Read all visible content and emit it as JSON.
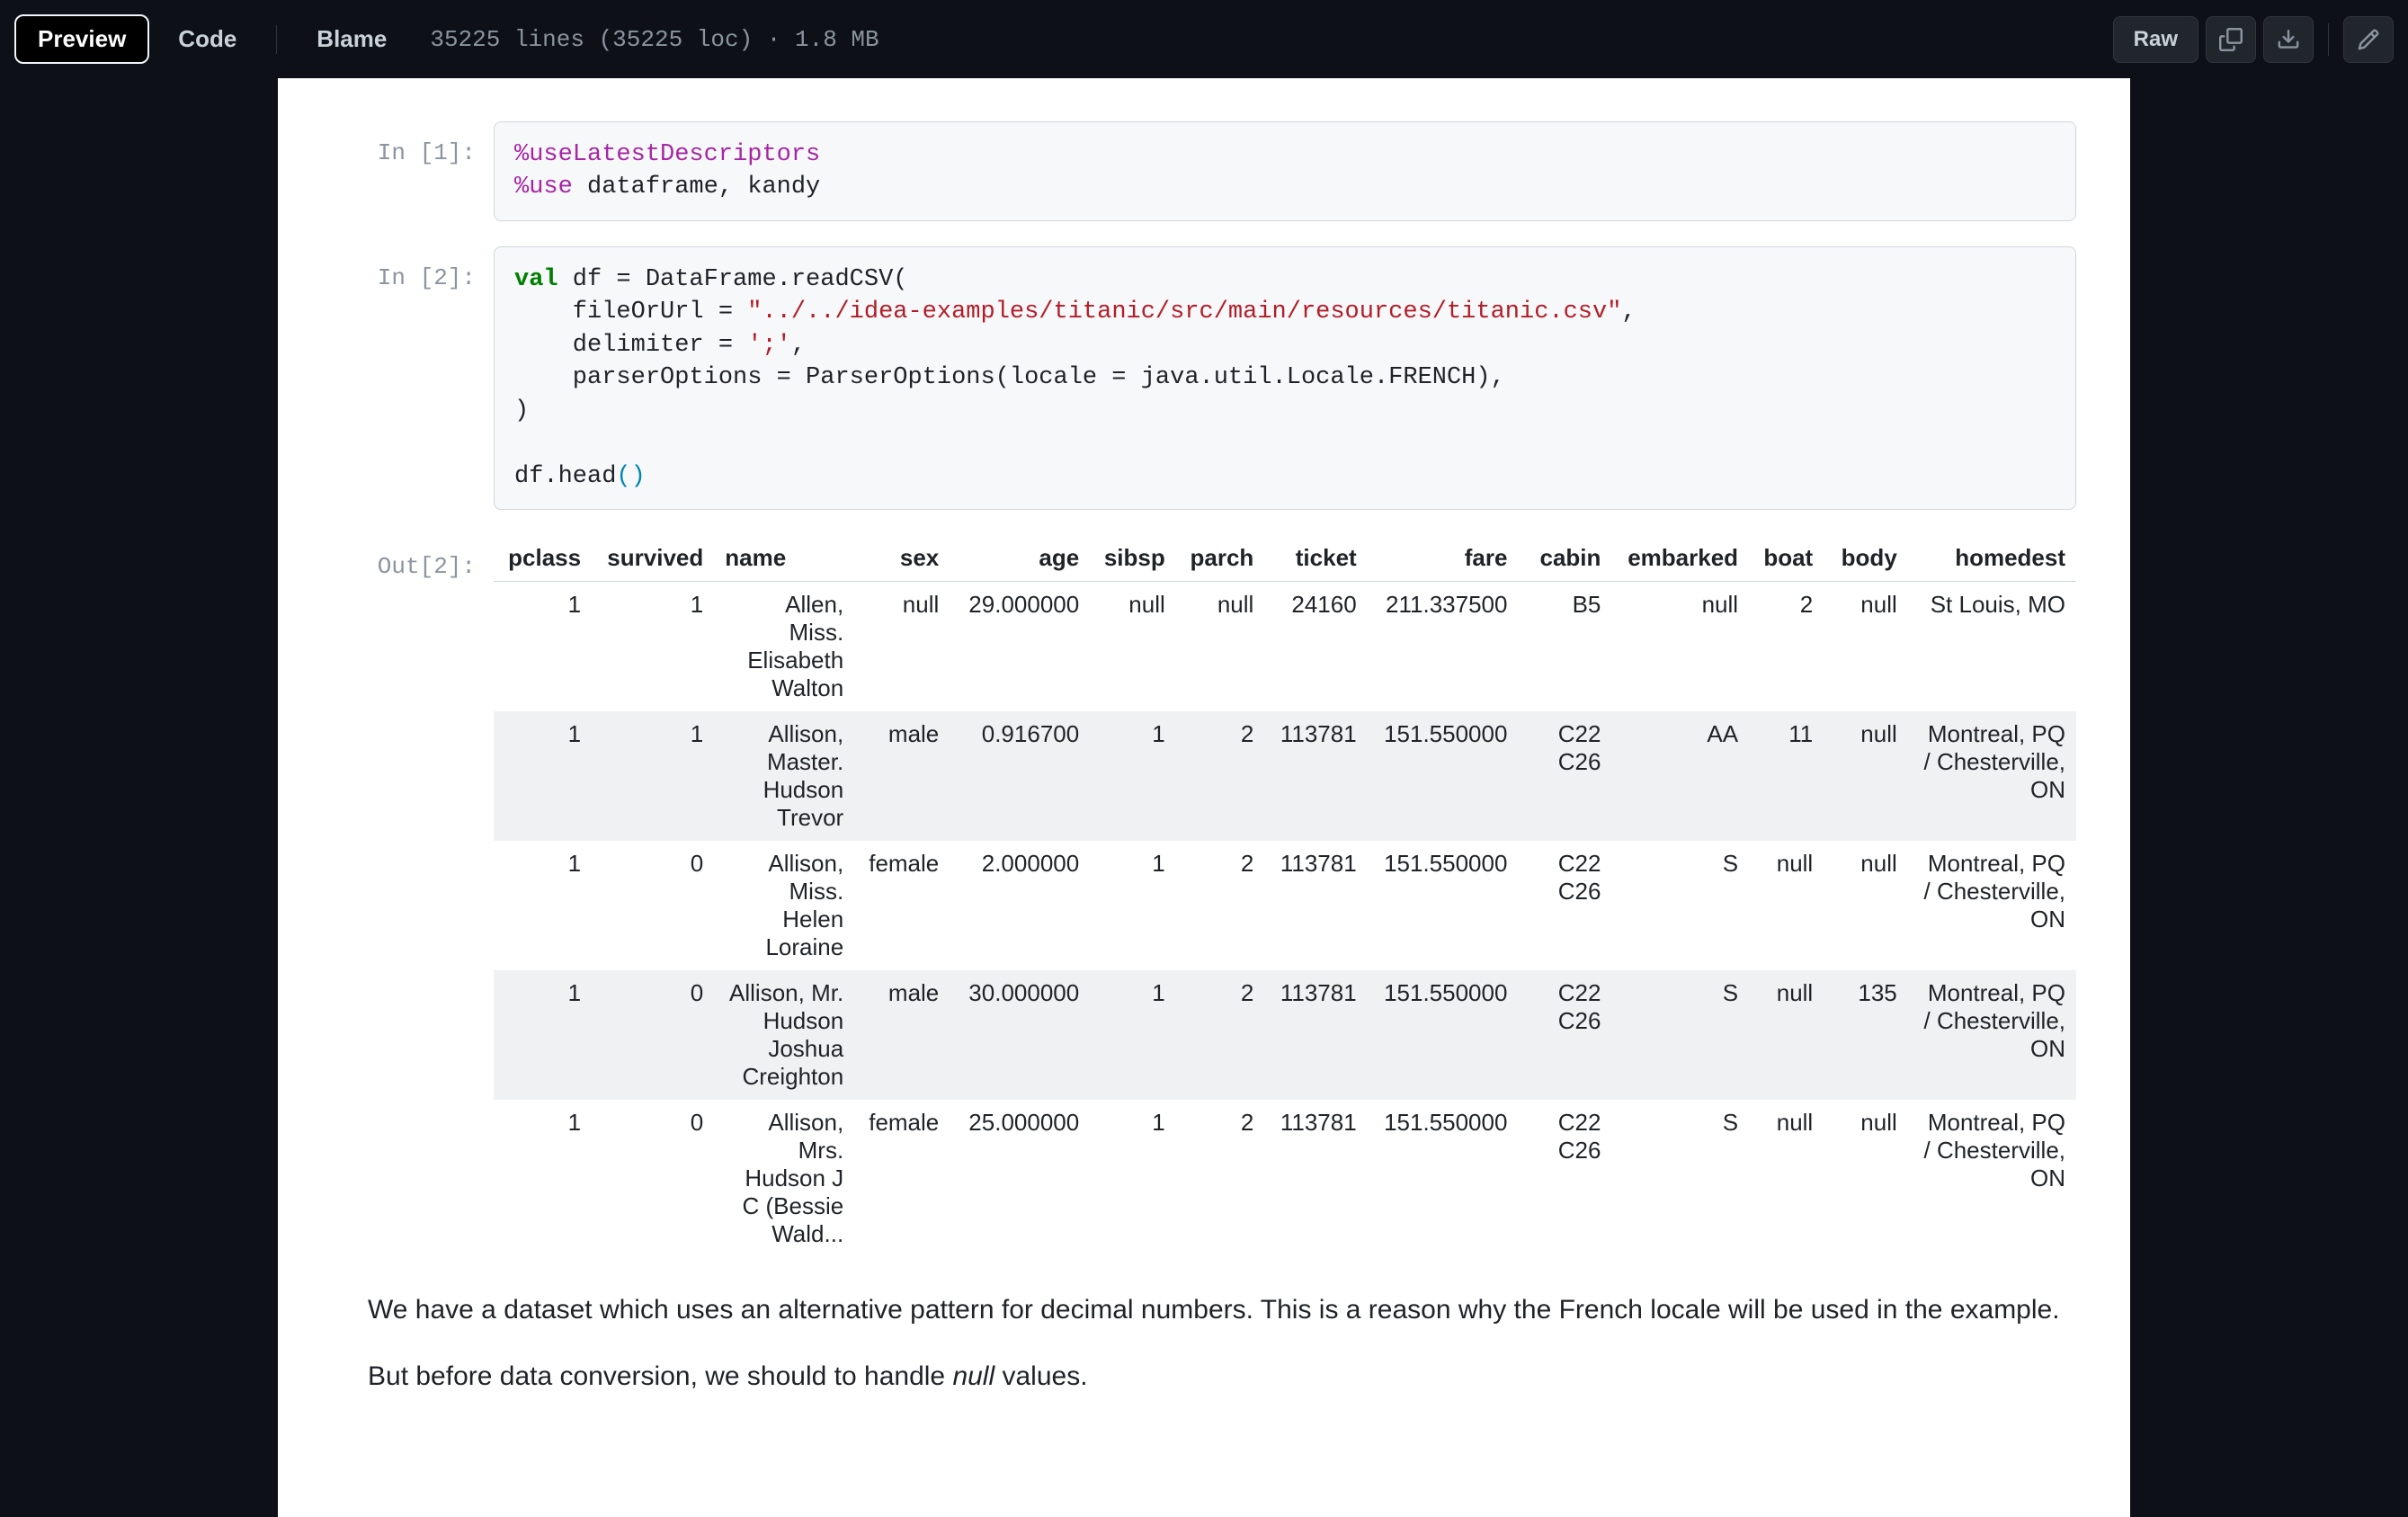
{
  "toolbar": {
    "tabs": {
      "preview": "Preview",
      "code": "Code",
      "blame": "Blame"
    },
    "meta": "35225 lines (35225 loc) · 1.8 MB",
    "raw_label": "Raw"
  },
  "cells": {
    "in1_prompt": "In [1]:",
    "in2_prompt": "In [2]:",
    "out2_prompt": "Out[2]:",
    "in1_code": {
      "l1_pre": "%",
      "l1_cmd": "useLatestDescriptors",
      "l2_pre": "%",
      "l2_cmd": "use",
      "l2_rest": " dataframe, kandy"
    },
    "in2_code": {
      "l1_val": "val",
      "l1_rest": " df = DataFrame.readCSV(",
      "l2_a": "    fileOrUrl = ",
      "l2_s": "\"../../idea-examples/titanic/src/main/resources/titanic.csv\"",
      "l2_c": ",",
      "l3_a": "    delimiter = ",
      "l3_s": "';'",
      "l3_c": ",",
      "l4": "    parserOptions = ParserOptions(locale = java.util.Locale.FRENCH),",
      "l5": ")",
      "l6_a": "df.head",
      "l6_b": "(",
      "l6_c": ")"
    }
  },
  "table": {
    "headers": [
      "pclass",
      "survived",
      "name",
      "sex",
      "age",
      "sibsp",
      "parch",
      "ticket",
      "fare",
      "cabin",
      "embarked",
      "boat",
      "body",
      "homedest"
    ],
    "rows": [
      {
        "pclass": "1",
        "survived": "1",
        "name": "Allen, Miss. Elisabeth Walton",
        "sex": "null",
        "age": "29.000000",
        "sibsp": "null",
        "parch": "null",
        "ticket": "24160",
        "fare": "211.337500",
        "cabin": "B5",
        "embarked": "null",
        "boat": "2",
        "body": "null",
        "homedest": "St Louis, MO"
      },
      {
        "pclass": "1",
        "survived": "1",
        "name": "Allison, Master. Hudson Trevor",
        "sex": "male",
        "age": "0.916700",
        "sibsp": "1",
        "parch": "2",
        "ticket": "113781",
        "fare": "151.550000",
        "cabin": "C22 C26",
        "embarked": "AA",
        "boat": "11",
        "body": "null",
        "homedest": "Montreal, PQ / Chesterville, ON"
      },
      {
        "pclass": "1",
        "survived": "0",
        "name": "Allison, Miss. Helen Loraine",
        "sex": "female",
        "age": "2.000000",
        "sibsp": "1",
        "parch": "2",
        "ticket": "113781",
        "fare": "151.550000",
        "cabin": "C22 C26",
        "embarked": "S",
        "boat": "null",
        "body": "null",
        "homedest": "Montreal, PQ / Chesterville, ON"
      },
      {
        "pclass": "1",
        "survived": "0",
        "name": "Allison, Mr. Hudson Joshua Creighton",
        "sex": "male",
        "age": "30.000000",
        "sibsp": "1",
        "parch": "2",
        "ticket": "113781",
        "fare": "151.550000",
        "cabin": "C22 C26",
        "embarked": "S",
        "boat": "null",
        "body": "135",
        "homedest": "Montreal, PQ / Chesterville, ON"
      },
      {
        "pclass": "1",
        "survived": "0",
        "name": "Allison, Mrs. Hudson J C (Bessie Wald...",
        "sex": "female",
        "age": "25.000000",
        "sibsp": "1",
        "parch": "2",
        "ticket": "113781",
        "fare": "151.550000",
        "cabin": "C22 C26",
        "embarked": "S",
        "boat": "null",
        "body": "null",
        "homedest": "Montreal, PQ / Chesterville, ON"
      }
    ]
  },
  "markdown": {
    "p1": "We have a dataset which uses an alternative pattern for decimal numbers. This is a reason why the French locale will be used in the example.",
    "p2_a": "But before data conversion, we should to handle ",
    "p2_em": "null",
    "p2_b": " values."
  }
}
